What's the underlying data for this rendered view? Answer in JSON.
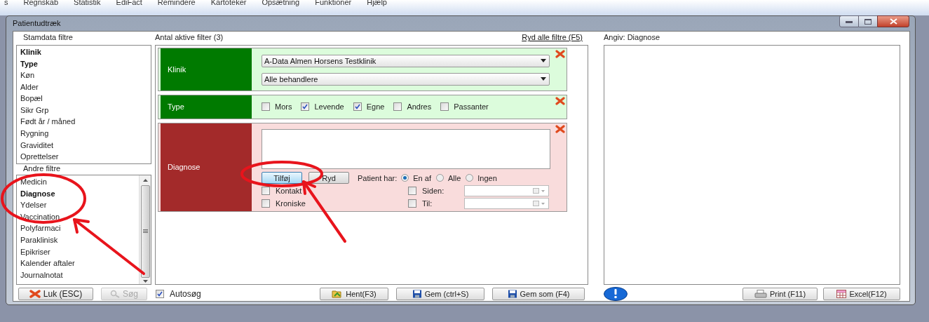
{
  "menu_bar": {
    "items": [
      "s",
      "Regnskab",
      "Statistik",
      "EdiFact",
      "Remindere",
      "Kartoteker",
      "Opsætning",
      "Funktioner",
      "Hjælp"
    ]
  },
  "window": {
    "title": "Patientudtræk"
  },
  "stamdata_filters": {
    "title": "Stamdata filtre",
    "items": [
      {
        "label": "Klinik",
        "active": true
      },
      {
        "label": "Type",
        "active": true
      },
      {
        "label": "Køn",
        "active": false
      },
      {
        "label": "Alder",
        "active": false
      },
      {
        "label": "Bopæl",
        "active": false
      },
      {
        "label": "Sikr Grp",
        "active": false
      },
      {
        "label": "Født år / måned",
        "active": false
      },
      {
        "label": "Rygning",
        "active": false
      },
      {
        "label": "Graviditet",
        "active": false
      },
      {
        "label": "Oprettelser",
        "active": false
      }
    ]
  },
  "other_filters": {
    "title": "Andre filtre",
    "items": [
      {
        "label": "Medicin",
        "active": false
      },
      {
        "label": "Diagnose",
        "active": true
      },
      {
        "label": "Ydelser",
        "active": false
      },
      {
        "label": "Vaccination",
        "active": false
      },
      {
        "label": "Polyfarmaci",
        "active": false
      },
      {
        "label": "Paraklinisk",
        "active": false
      },
      {
        "label": "Epikriser",
        "active": false
      },
      {
        "label": "Kalender aftaler",
        "active": false
      },
      {
        "label": "Journalnotat",
        "active": false
      }
    ]
  },
  "active_filters": {
    "header": "Antal aktive filter (3)",
    "clear_all": "Ryd alle filtre (F5)",
    "cards": [
      {
        "kind": "clinic",
        "label": "Klinik",
        "color": "#007a00",
        "dropdowns": [
          "A-Data Almen Horsens Testklinik",
          "Alle behandlere"
        ]
      },
      {
        "kind": "type",
        "label": "Type",
        "color": "#007a00",
        "options": [
          {
            "label": "Mors",
            "checked": false
          },
          {
            "label": "Levende",
            "checked": true
          },
          {
            "label": "Egne",
            "checked": true
          },
          {
            "label": "Andres",
            "checked": false
          },
          {
            "label": "Passanter",
            "checked": false
          }
        ]
      },
      {
        "kind": "diagnosis",
        "label": "Diagnose",
        "color": "#a32a2a",
        "buttons": [
          {
            "label": "Tilføj",
            "focused": true
          },
          {
            "label": "Ryd",
            "focused": false
          }
        ],
        "patient_has": {
          "label": "Patient har:",
          "options": [
            {
              "label": "En af",
              "selected": true
            },
            {
              "label": "Alle",
              "selected": false
            },
            {
              "label": "Ingen",
              "selected": false
            }
          ]
        },
        "options": [
          {
            "label": "Kontakt",
            "checked": false
          },
          {
            "label": "Kroniske",
            "checked": false
          }
        ],
        "dates": [
          {
            "label": "Siden:",
            "checked": false
          },
          {
            "label": "Til:",
            "checked": false
          }
        ]
      }
    ]
  },
  "footer_left": {
    "close": "Luk (ESC)",
    "search": {
      "label": "Søg",
      "disabled": true
    },
    "autosearch": {
      "label": "Autosøg",
      "checked": true
    }
  },
  "footer_middle": [
    {
      "kind": "open",
      "label": "Hent(F3)"
    },
    {
      "kind": "save",
      "label": "Gem (ctrl+S)"
    },
    {
      "kind": "save",
      "label": "Gem som (F4)"
    }
  ],
  "detail": {
    "title": "Angiv: Diagnose"
  },
  "footer_right": [
    {
      "kind": "print",
      "label": "Print (F11)"
    },
    {
      "kind": "excel",
      "label": "Excel(F12)"
    }
  ]
}
